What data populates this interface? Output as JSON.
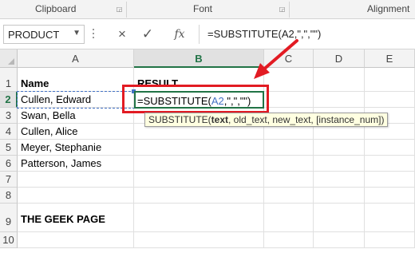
{
  "ribbon": {
    "groups": [
      "Clipboard",
      "Font",
      "Alignment"
    ]
  },
  "formula_bar": {
    "name_box": "PRODUCT",
    "cancel_icon": "×",
    "enter_icon": "✓",
    "fx_label": "fx",
    "formula": "=SUBSTITUTE(A2,\",\",\"\")"
  },
  "columns": [
    "A",
    "B",
    "C",
    "D",
    "E"
  ],
  "rows": [
    "1",
    "2",
    "3",
    "4",
    "5",
    "6",
    "7",
    "8",
    "9",
    "10"
  ],
  "cells": {
    "A1": "Name",
    "B1": "RESULT",
    "A2": "Cullen, Edward",
    "A3": "Swan, Bella",
    "A4": "Cullen, Alice",
    "A5": "Meyer, Stephanie",
    "A6": "Patterson, James",
    "A9": "THE GEEK PAGE"
  },
  "active_cell": {
    "prefix": "=SUBSTITUTE(",
    "ref": "A2",
    "suffix": ",\",\",\"\")"
  },
  "tooltip": {
    "func": "SUBSTITUTE(",
    "arg1": "text",
    "rest": ", old_text, new_text, [instance_num])"
  },
  "colors": {
    "accent": "#217346",
    "highlight": "#e21b23",
    "reference": "#4472c4"
  }
}
